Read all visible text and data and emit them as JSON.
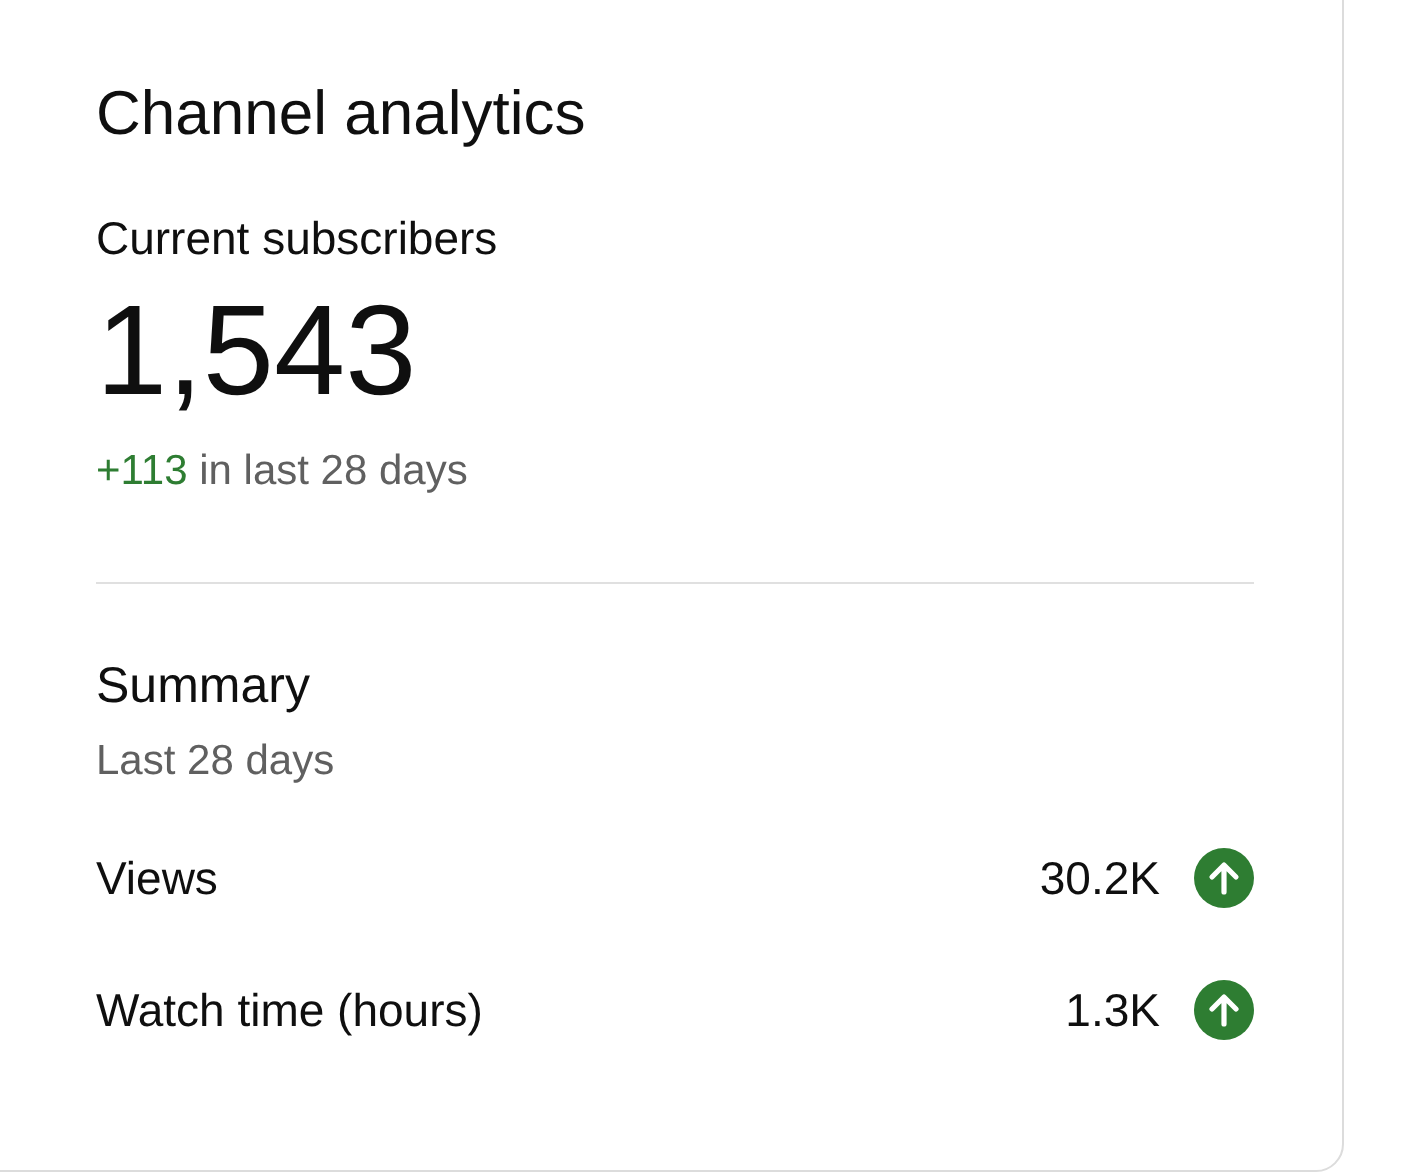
{
  "title": "Channel analytics",
  "subscribers": {
    "label": "Current subscribers",
    "count": "1,543",
    "change": "+113",
    "change_text": "in last 28 days"
  },
  "summary": {
    "title": "Summary",
    "period": "Last 28 days",
    "rows": [
      {
        "label": "Views",
        "value": "30.2K",
        "rising": true
      },
      {
        "label": "Watch time (hours)",
        "value": "1.3K",
        "rising": true
      }
    ]
  }
}
